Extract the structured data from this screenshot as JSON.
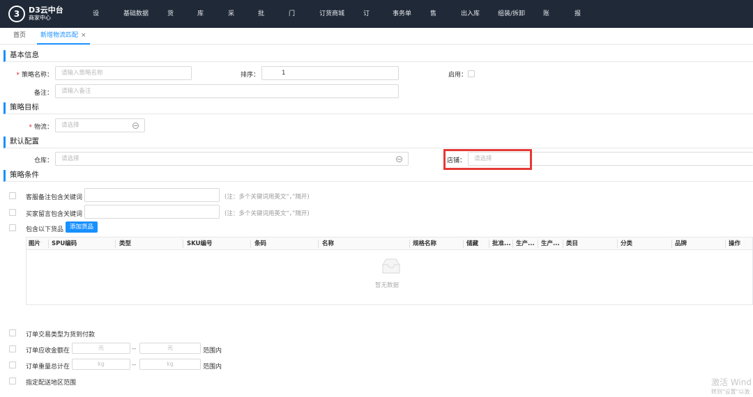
{
  "app": {
    "logo_mark": "3",
    "logo_title": "D3云中台",
    "logo_subtitle": "商家中心"
  },
  "nav": {
    "items": [
      "设置",
      "基础数据",
      "货品",
      "库存",
      "采购",
      "批发",
      "门店",
      "订货商城",
      "订单",
      "事务单",
      "售后",
      "出入库",
      "组装/拆卸",
      "账款",
      "报表"
    ]
  },
  "tabs": {
    "home": "首页",
    "active": "新增物流匹配",
    "close": "×"
  },
  "basic": {
    "title": "基本信息",
    "name_label": "策略名称：",
    "name_placeholder": "请输入策略名称",
    "sort_label": "排序：",
    "sort_value": "1",
    "enable_label": "启用：",
    "remark_label": "备注：",
    "remark_placeholder": "请输入备注"
  },
  "target": {
    "title": "策略目标",
    "logistics_label": "物流：",
    "logistics_placeholder": "请选择"
  },
  "defaults": {
    "title": "默认配置",
    "warehouse_label": "仓库：",
    "warehouse_placeholder": "请选择",
    "shop_label": "店铺：",
    "shop_placeholder": "请选择"
  },
  "conditions": {
    "title": "策略条件",
    "service_note_label": "客服备注包含关键词",
    "buyer_msg_label": "买家留言包含关键词",
    "hint": "(注：多个关键词用英文“，”隔开)",
    "goods_label": "包含以下货品",
    "add_goods": "添加货品",
    "table_headers": [
      "图片",
      "SPU编码",
      "类型",
      "SKU编号",
      "条码",
      "名称",
      "规格名称",
      "储藏",
      "批准...",
      "生产...",
      "生产...",
      "类目",
      "分类",
      "品牌",
      "操作"
    ],
    "empty_text": "暂无数据",
    "cod_label": "订单交易类型为货到付款",
    "amount_label": "订单应收金额在",
    "amount_unit": "元",
    "range_sep": "--",
    "range_suffix": "范围内",
    "weight_label": "订单重量总计在",
    "weight_unit": "kg",
    "area_label": "指定配送地区范围"
  },
  "watermark": {
    "line1": "激活 Wind",
    "line2": "转到\"设置\"以激"
  }
}
